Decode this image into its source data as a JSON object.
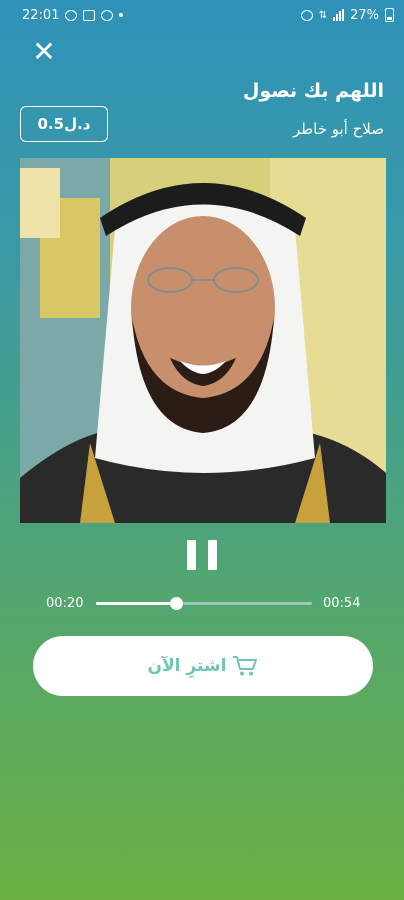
{
  "status_bar": {
    "time": "22:01",
    "battery": "27%",
    "icons": [
      "whatsapp-icon",
      "gallery-icon",
      "minus-circle-icon",
      "dot-icon",
      "alarm-icon",
      "data-icon",
      "signal-icon",
      "battery-icon"
    ]
  },
  "player": {
    "close_icon": "close-icon",
    "title": "اللهم بك نصول",
    "artist": "صلاح أبو خاطر",
    "price": "0.5د.ل",
    "control_icon": "pause-icon",
    "elapsed": "00:20",
    "total": "00:54",
    "progress": 0.37,
    "buy_label": "اشترِ الآن",
    "buy_icon": "cart-icon"
  },
  "colors": {
    "gradient_top": "#2f92b8",
    "gradient_bottom": "#6ab042",
    "buy_text": "#6fc7b0"
  }
}
